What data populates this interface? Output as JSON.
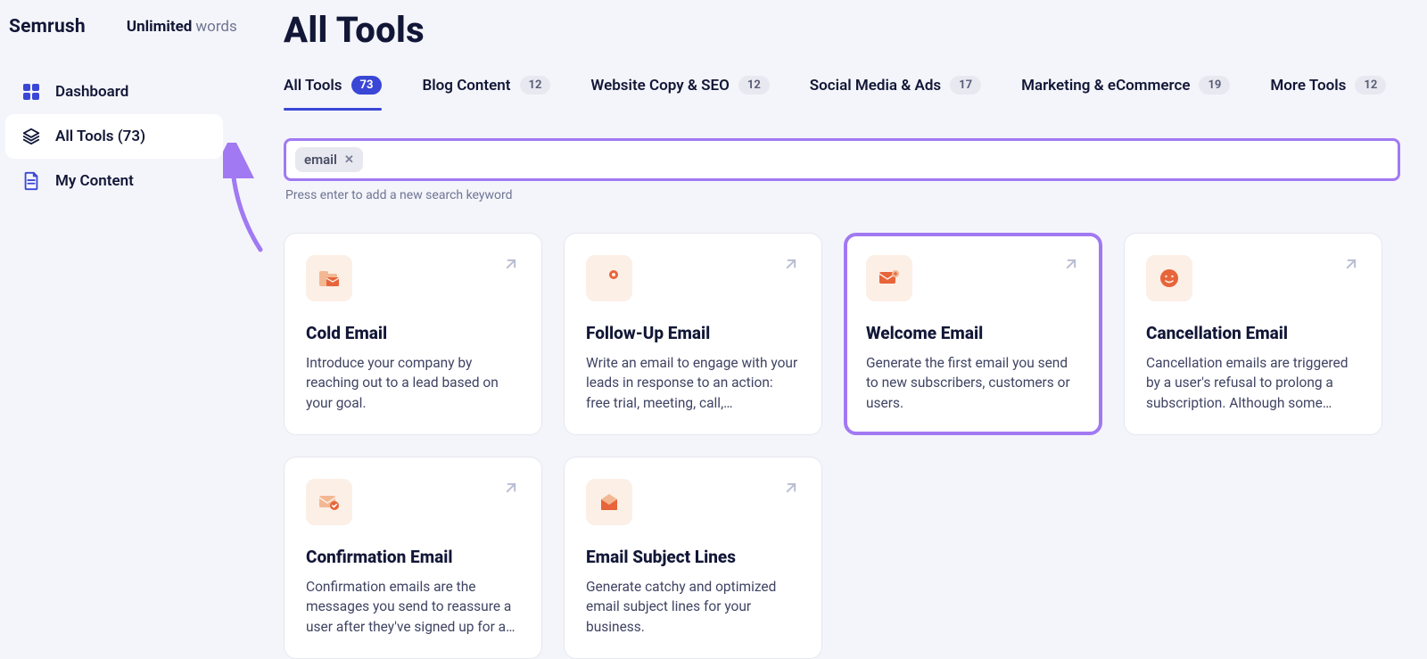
{
  "brand": "Semrush",
  "words_label_bold": "Unlimited",
  "words_label_light": "words",
  "sidebar": {
    "items": [
      {
        "label": "Dashboard"
      },
      {
        "label": "All Tools (73)"
      },
      {
        "label": "My Content"
      }
    ]
  },
  "page_title": "All Tools",
  "tabs": [
    {
      "label": "All Tools",
      "count": "73",
      "active": true
    },
    {
      "label": "Blog Content",
      "count": "12"
    },
    {
      "label": "Website Copy & SEO",
      "count": "12"
    },
    {
      "label": "Social Media & Ads",
      "count": "17"
    },
    {
      "label": "Marketing & eCommerce",
      "count": "19"
    },
    {
      "label": "More Tools",
      "count": "12"
    }
  ],
  "search": {
    "chip": "email",
    "hint": "Press enter to add a new search keyword"
  },
  "cards": [
    {
      "title": "Cold Email",
      "desc": "Introduce your company by reaching out to a lead based on your goal.",
      "icon": "folder-mail-icon"
    },
    {
      "title": "Follow-Up Email",
      "desc": "Write an email to engage with your leads in response to an action: free trial, meeting, call,…",
      "icon": "reply-target-icon"
    },
    {
      "title": "Welcome Email",
      "desc": "Generate the first email you send to new subscribers, customers or users.",
      "icon": "mail-plus-icon",
      "highlight": true
    },
    {
      "title": "Cancellation Email",
      "desc": "Cancellation emails are triggered by a user's refusal to prolong a subscription. Although some…",
      "icon": "smile-icon"
    },
    {
      "title": "Confirmation Email",
      "desc": "Confirmation emails are the messages you send to reassure a user after they've signed up for a…",
      "icon": "mail-check-icon"
    },
    {
      "title": "Email Subject Lines",
      "desc": "Generate catchy and optimized email subject lines for your business.",
      "icon": "open-mail-icon"
    }
  ]
}
